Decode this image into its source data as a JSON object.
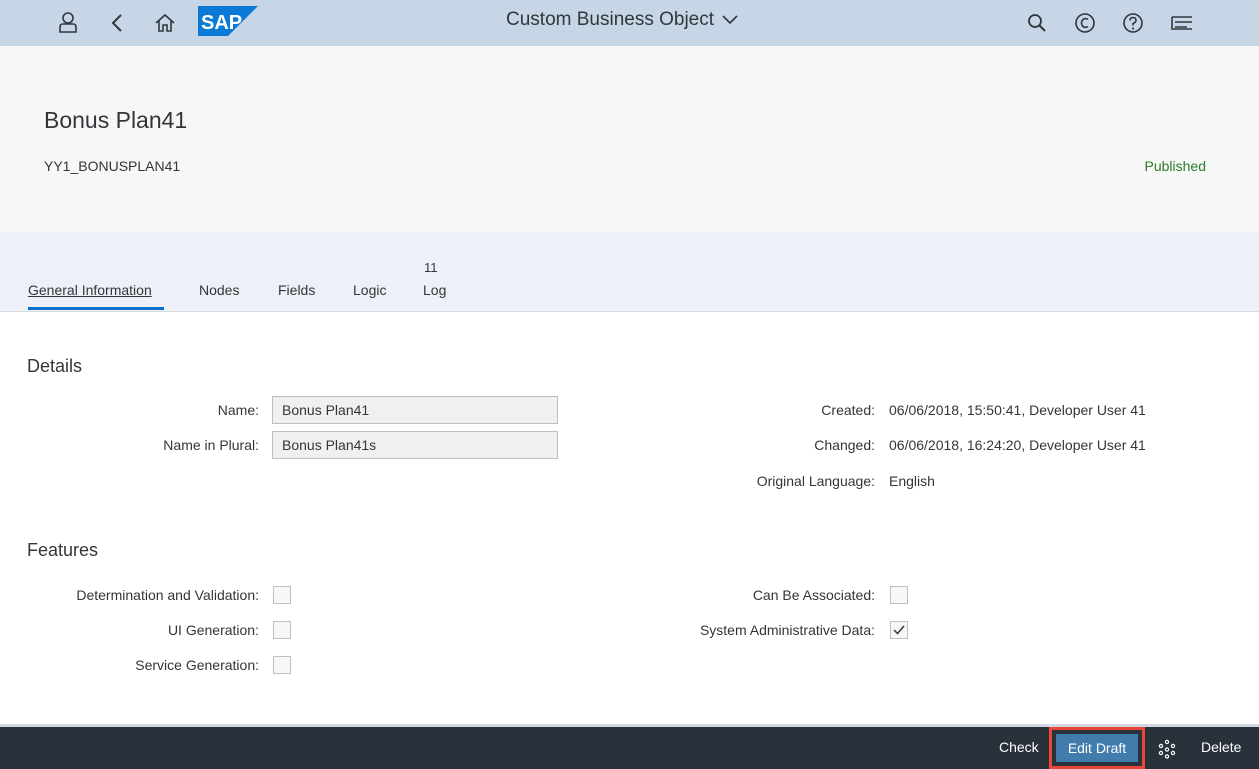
{
  "shell": {
    "app_title": "Custom Business Object",
    "logo_text": "SAP",
    "icons": [
      "user-icon",
      "back-icon",
      "home-icon",
      "search-icon",
      "copilot-icon",
      "help-icon",
      "notifications-icon"
    ]
  },
  "object": {
    "title": "Bonus Plan41",
    "id": "YY1_BONUSPLAN41",
    "status": "Published",
    "status_color": "#2b7d2b"
  },
  "tabs": {
    "general": "General Information",
    "nodes": "Nodes",
    "fields": "Fields",
    "logic": "Logic",
    "log": "Log",
    "log_count": "11"
  },
  "details": {
    "heading": "Details",
    "name_label": "Name:",
    "name_value": "Bonus Plan41",
    "plural_label": "Name in Plural:",
    "plural_value": "Bonus Plan41s",
    "created_label": "Created:",
    "created_value": "06/06/2018, 15:50:41, Developer User 41",
    "changed_label": "Changed:",
    "changed_value": "06/06/2018, 16:24:20, Developer User 41",
    "language_label": "Original Language:",
    "language_value": "English"
  },
  "features": {
    "heading": "Features",
    "items": [
      {
        "label": "Determination and Validation:",
        "checked": false
      },
      {
        "label": "UI Generation:",
        "checked": false
      },
      {
        "label": "Service Generation:",
        "checked": false
      },
      {
        "label": "Can Be Associated:",
        "checked": false
      },
      {
        "label": "System Administrative Data:",
        "checked": true
      }
    ]
  },
  "footer": {
    "check": "Check",
    "edit_draft": "Edit Draft",
    "delete": "Delete",
    "accent": "#427cac"
  }
}
